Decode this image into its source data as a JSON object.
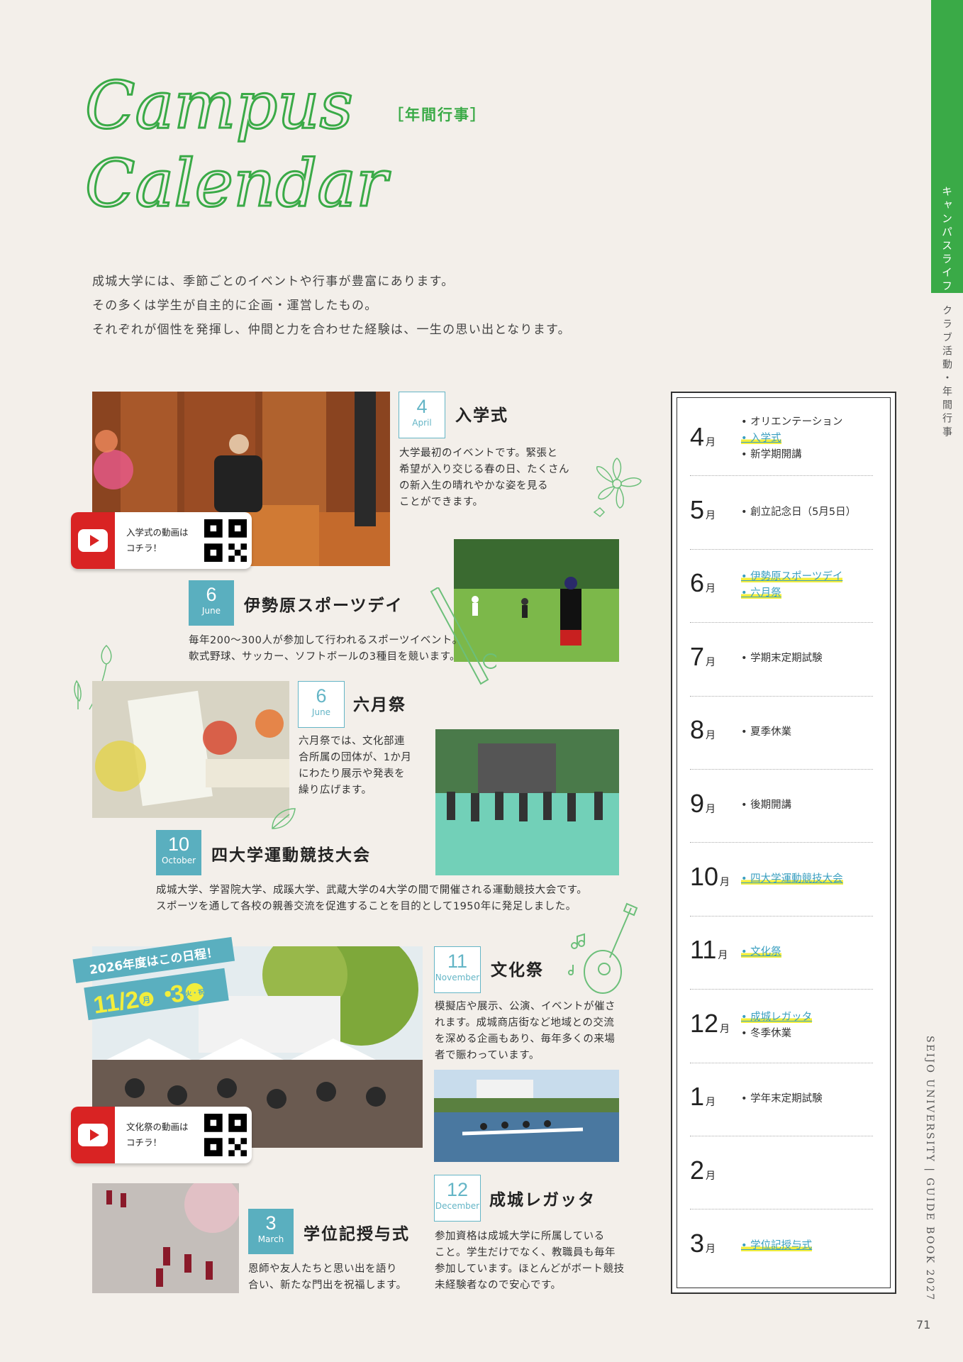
{
  "title": {
    "script_line1": "Campus",
    "script_line2": "Calendar",
    "jp": "［年間行事］"
  },
  "intro": [
    "成城大学には、季節ごとのイベントや行事が豊富にあります。",
    "その多くは学生が自主的に企画・運営したもの。",
    "それぞれが個性を発揮し、仲間と力を合わせた経験は、一生の思い出となります。"
  ],
  "side": {
    "tab": "キャンパスライフ",
    "sub": "クラブ活動・年間行事",
    "brand": "SEIJO UNIVERSITY | GUIDE BOOK 2027",
    "page": "71"
  },
  "events": {
    "nyugaku": {
      "num": "4",
      "month": "April",
      "title": "入学式",
      "desc": [
        "大学最初のイベントです。緊張と",
        "希望が入り交じる春の日、たくさん",
        "の新入生の晴れやかな姿を見る",
        "ことができます。"
      ]
    },
    "sports": {
      "num": "6",
      "month": "June",
      "title": "伊勢原スポーツデイ",
      "desc": [
        "毎年200〜300人が参加して行われるスポーツイベント。",
        "軟式野球、サッカー、ソフトボールの3種目を競います。"
      ]
    },
    "rokugatsu": {
      "num": "6",
      "month": "June",
      "title": "六月祭",
      "desc": [
        "六月祭では、文化部連",
        "合所属の団体が、1か月",
        "にわたり展示や発表を",
        "繰り広げます。"
      ]
    },
    "yondai": {
      "num": "10",
      "month": "October",
      "title": "四大学運動競技大会",
      "desc": [
        "成城大学、学習院大学、成蹊大学、武蔵大学の4大学の間で開催される運動競技大会です。",
        "スポーツを通して各校の親善交流を促進することを目的として1950年に発足しました。"
      ]
    },
    "bunka": {
      "num": "11",
      "month": "November",
      "title": "文化祭",
      "desc": [
        "模擬店や展示、公演、イベントが催さ",
        "れます。成城商店街など地域との交流",
        "を深める企画もあり、毎年多くの来場",
        "者で賑わっています。"
      ]
    },
    "regatta": {
      "num": "12",
      "month": "December",
      "title": "成城レガッタ",
      "desc": [
        "参加資格は成城大学に所属している",
        "こと。学生だけでなく、教職員も毎年",
        "参加しています。ほとんどがボート競技",
        "未経験者なので安心です。"
      ]
    },
    "gakui": {
      "num": "3",
      "month": "March",
      "title": "学位記授与式",
      "desc": [
        "恩師や友人たちと思い出を語り",
        "合い、新たな門出を祝福します。"
      ]
    }
  },
  "videos": {
    "nyugaku": [
      "入学式の動画は",
      "コチラ！"
    ],
    "bunka": [
      "文化祭の動画は",
      "コチラ！"
    ]
  },
  "banner": {
    "line1": "2026年度はこの日程！",
    "date_a": "11/2",
    "day_a": "月",
    "date_b": "3",
    "day_b": "火・祝"
  },
  "calendar": [
    {
      "month": "4",
      "unit": "月",
      "items": [
        {
          "text": "オリエンテーション",
          "hl": false
        },
        {
          "text": "入学式",
          "hl": true
        },
        {
          "text": "新学期開講",
          "hl": false
        }
      ]
    },
    {
      "month": "5",
      "unit": "月",
      "items": [
        {
          "text": "創立記念日（5月5日）",
          "hl": false
        }
      ]
    },
    {
      "month": "6",
      "unit": "月",
      "items": [
        {
          "text": "伊勢原スポーツデイ",
          "hl": true
        },
        {
          "text": "六月祭",
          "hl": true
        }
      ]
    },
    {
      "month": "7",
      "unit": "月",
      "items": [
        {
          "text": "学期末定期試験",
          "hl": false
        }
      ]
    },
    {
      "month": "8",
      "unit": "月",
      "items": [
        {
          "text": "夏季休業",
          "hl": false
        }
      ]
    },
    {
      "month": "9",
      "unit": "月",
      "items": [
        {
          "text": "後期開講",
          "hl": false
        }
      ]
    },
    {
      "month": "10",
      "unit": "月",
      "items": [
        {
          "text": "四大学運動競技大会",
          "hl": true
        }
      ]
    },
    {
      "month": "11",
      "unit": "月",
      "items": [
        {
          "text": "文化祭",
          "hl": true
        }
      ]
    },
    {
      "month": "12",
      "unit": "月",
      "items": [
        {
          "text": "成城レガッタ",
          "hl": true
        },
        {
          "text": "冬季休業",
          "hl": false
        }
      ]
    },
    {
      "month": "1",
      "unit": "月",
      "items": [
        {
          "text": "学年末定期試験",
          "hl": false
        }
      ]
    },
    {
      "month": "2",
      "unit": "月",
      "items": []
    },
    {
      "month": "3",
      "unit": "月",
      "items": [
        {
          "text": "学位記授与式",
          "hl": true
        }
      ]
    }
  ],
  "colors": {
    "accent_green": "#3aaa47",
    "badge_teal": "#5aafbf",
    "youtube_red": "#d92323",
    "highlight_yellow": "#f2ee3c"
  }
}
